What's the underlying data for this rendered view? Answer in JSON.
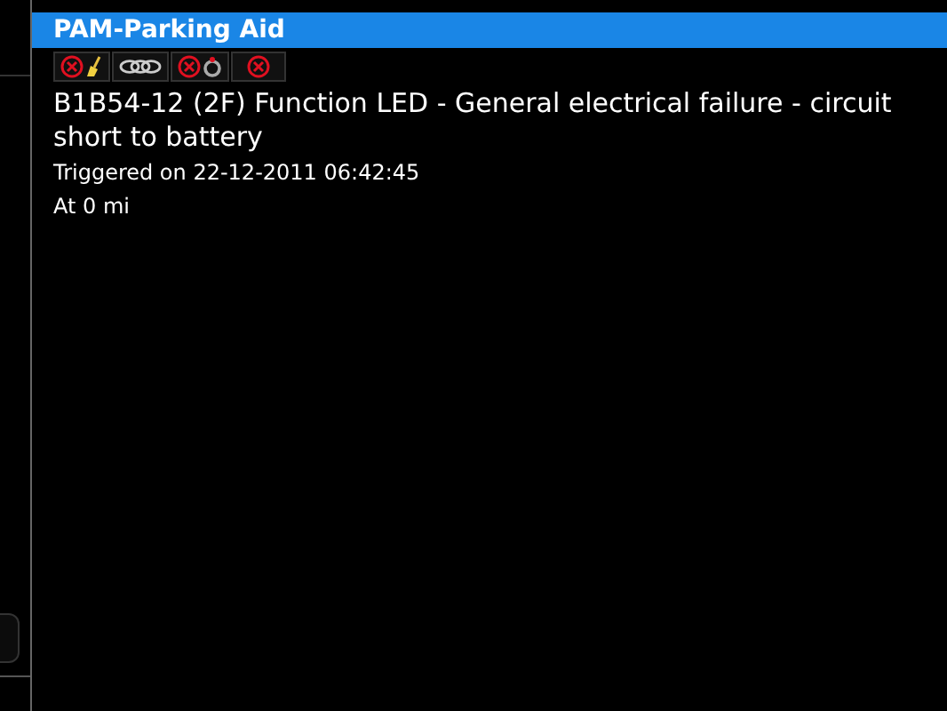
{
  "header": {
    "title": "PAM-Parking Aid"
  },
  "fault": {
    "description": "B1B54-12 (2F) Function LED - General electrical failure - circuit short to battery",
    "triggered": "Triggered on 22-12-2011 06:42:45",
    "mileage": "At 0 mi"
  }
}
